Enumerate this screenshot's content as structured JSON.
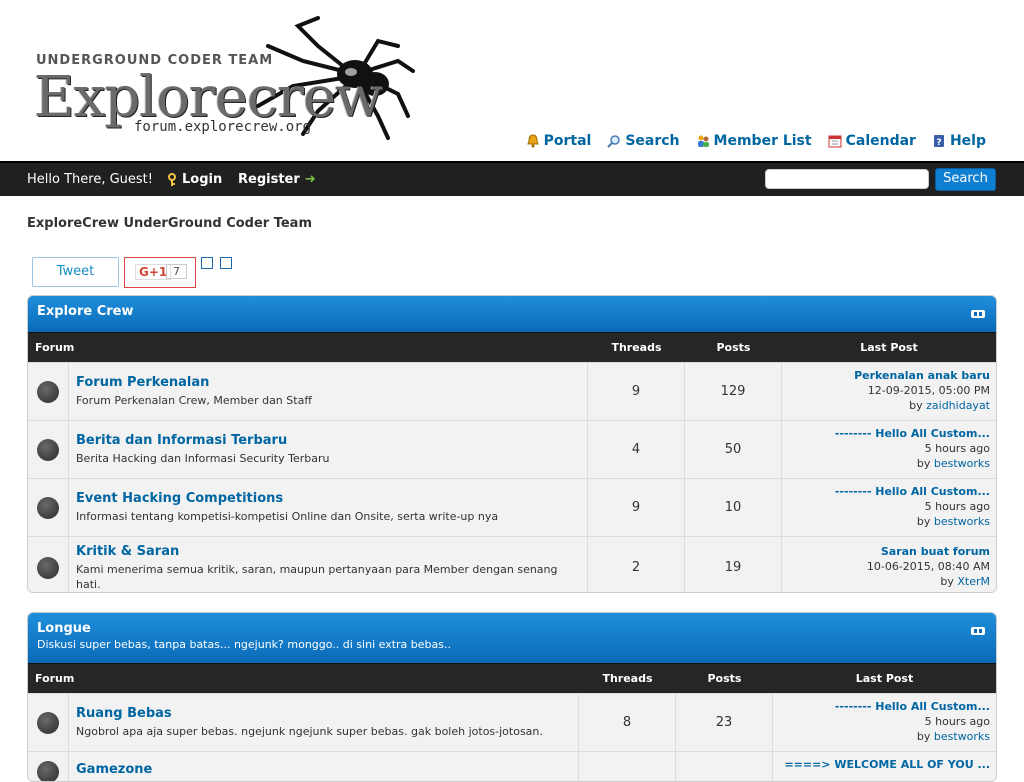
{
  "logo": {
    "team_text": "UNDERGROUND CODER TEAM",
    "word": "Explorecrew",
    "url": "forum.explorecrew.org"
  },
  "menu": [
    {
      "label": "Portal",
      "icon": "portal-bell-icon"
    },
    {
      "label": "Search",
      "icon": "magnifier-icon"
    },
    {
      "label": "Member List",
      "icon": "members-icon"
    },
    {
      "label": "Calendar",
      "icon": "calendar-icon"
    },
    {
      "label": "Help",
      "icon": "help-icon"
    }
  ],
  "panel": {
    "hello": "Hello There, Guest!",
    "login": "Login",
    "register": "Register",
    "search_button": "Search",
    "search_value": ""
  },
  "board_title": "ExploreCrew UnderGround Coder Team",
  "social": {
    "tweet": "Tweet",
    "gplus_label": "G+1",
    "gplus_count": "7"
  },
  "columns": {
    "forum": "Forum",
    "threads": "Threads",
    "posts": "Posts",
    "last_post": "Last Post"
  },
  "categories": [
    {
      "title": "Explore Crew",
      "description": "",
      "forums": [
        {
          "name": "Forum Perkenalan",
          "desc": "Forum Perkenalan Crew, Member dan Staff",
          "threads": "9",
          "posts": "129",
          "lp_subject": "Perkenalan anak baru",
          "lp_time": "12-09-2015, 05:00 PM",
          "lp_by": "by",
          "lp_user": "zaidhidayat"
        },
        {
          "name": "Berita dan Informasi Terbaru",
          "desc": "Berita Hacking dan Informasi Security Terbaru",
          "threads": "4",
          "posts": "50",
          "lp_subject": "-------- Hello All Custom...",
          "lp_time": "5 hours ago",
          "lp_by": "by",
          "lp_user": "bestworks"
        },
        {
          "name": "Event Hacking Competitions",
          "desc": "Informasi tentang kompetisi-kompetisi Online dan Onsite, serta write-up nya",
          "threads": "9",
          "posts": "10",
          "lp_subject": "-------- Hello All Custom...",
          "lp_time": "5 hours ago",
          "lp_by": "by",
          "lp_user": "bestworks"
        },
        {
          "name": "Kritik & Saran",
          "desc": "Kami menerima semua kritik, saran, maupun pertanyaan para Member dengan senang hati.",
          "threads": "2",
          "posts": "19",
          "lp_subject": "Saran buat forum",
          "lp_time": "10-06-2015, 08:40 AM",
          "lp_by": "by",
          "lp_user": "XterM"
        }
      ]
    },
    {
      "title": "Longue",
      "description": "Diskusi super bebas, tanpa batas... ngejunk? monggo.. di sini extra bebas..",
      "forums": [
        {
          "name": "Ruang Bebas",
          "desc": "Ngobrol apa aja super bebas. ngejunk ngejunk super bebas. gak boleh jotos-jotosan.",
          "threads": "8",
          "posts": "23",
          "lp_subject": "-------- Hello All Custom...",
          "lp_time": "5 hours ago",
          "lp_by": "by",
          "lp_user": "bestworks"
        },
        {
          "name": "Gamezone",
          "desc": "",
          "threads": "",
          "posts": "",
          "lp_subject": "====> WELCOME ALL OF YOU ...",
          "lp_time": "",
          "lp_by": "",
          "lp_user": ""
        }
      ]
    }
  ]
}
